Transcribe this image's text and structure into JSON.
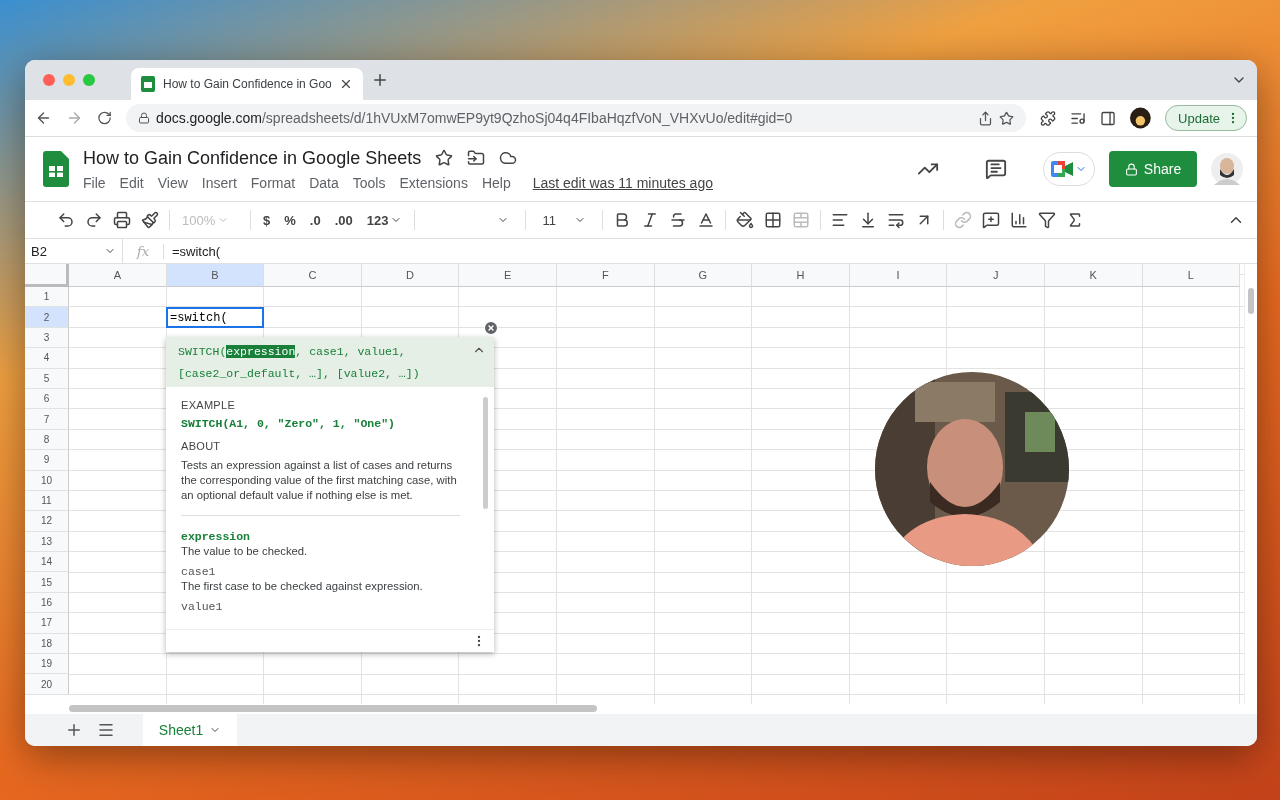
{
  "browser": {
    "tabs": [
      {
        "title": "How to Gain Confidence in Goo",
        "selected": true
      }
    ],
    "url_host": "docs.google.com",
    "url_path": "/spreadsheets/d/1hVUxM7omwEP9yt9QzhoSj04q4FIbaHqzfVoN_VHXvUo/edit#gid=0",
    "update_label": "Update"
  },
  "doc": {
    "title": "How to Gain Confidence in Google Sheets",
    "menus": [
      "File",
      "Edit",
      "View",
      "Insert",
      "Format",
      "Data",
      "Tools",
      "Extensions",
      "Help"
    ],
    "last_edit": "Last edit was 11 minutes ago",
    "share_label": "Share"
  },
  "toolbar": {
    "zoom": "100%",
    "currency": "$",
    "percent": "%",
    "decimals_less": ".0",
    "decimals_more": ".00",
    "number_format": "123",
    "font_size": "11"
  },
  "formula_bar": {
    "cell_ref": "B2",
    "fx_label": "fx",
    "formula": "=switch("
  },
  "grid": {
    "columns": [
      {
        "label": "A",
        "selected": false
      },
      {
        "label": "B",
        "selected": true
      },
      {
        "label": "C",
        "selected": false
      },
      {
        "label": "D",
        "selected": false
      },
      {
        "label": "E",
        "selected": false
      },
      {
        "label": "F",
        "selected": false
      },
      {
        "label": "G",
        "selected": false
      },
      {
        "label": "H",
        "selected": false
      },
      {
        "label": "I",
        "selected": false
      },
      {
        "label": "J",
        "selected": false
      },
      {
        "label": "K",
        "selected": false
      },
      {
        "label": "L",
        "selected": false
      }
    ],
    "rows": [
      {
        "label": "1",
        "selected": false
      },
      {
        "label": "2",
        "selected": true
      },
      {
        "label": "3",
        "selected": false
      },
      {
        "label": "4",
        "selected": false
      },
      {
        "label": "5",
        "selected": false
      },
      {
        "label": "6",
        "selected": false
      },
      {
        "label": "7",
        "selected": false
      },
      {
        "label": "8",
        "selected": false
      },
      {
        "label": "9",
        "selected": false
      },
      {
        "label": "10",
        "selected": false
      },
      {
        "label": "11",
        "selected": false
      },
      {
        "label": "12",
        "selected": false
      },
      {
        "label": "13",
        "selected": false
      },
      {
        "label": "14",
        "selected": false
      },
      {
        "label": "15",
        "selected": false
      },
      {
        "label": "16",
        "selected": false
      },
      {
        "label": "17",
        "selected": false
      },
      {
        "label": "18",
        "selected": false
      },
      {
        "label": "19",
        "selected": false
      },
      {
        "label": "20",
        "selected": false
      }
    ],
    "editor_value": "=switch("
  },
  "formula_help": {
    "signature_lines": [
      [
        {
          "text": "SWITCH(",
          "highlighted": false
        },
        {
          "text": "expression",
          "highlighted": true
        },
        {
          "text": ", case1, value1,",
          "highlighted": false
        }
      ],
      [
        {
          "text": "[case2_or_default, …], [value2, …])",
          "highlighted": false
        }
      ]
    ],
    "example_label": "EXAMPLE",
    "example": "SWITCH(A1, 0, \"Zero\", 1, \"One\")",
    "about_label": "ABOUT",
    "about": "Tests an expression against a list of cases and returns the corresponding value of the first matching case, with an optional default value if nothing else is met.",
    "params": [
      {
        "name": "expression",
        "highlighted": true,
        "description": "The value to be checked."
      },
      {
        "name": "case1",
        "highlighted": false,
        "description": "The first case to be checked against expression."
      },
      {
        "name": "value1",
        "highlighted": false
      }
    ]
  },
  "sheets": [
    {
      "name": "Sheet1",
      "selected": true
    }
  ]
}
